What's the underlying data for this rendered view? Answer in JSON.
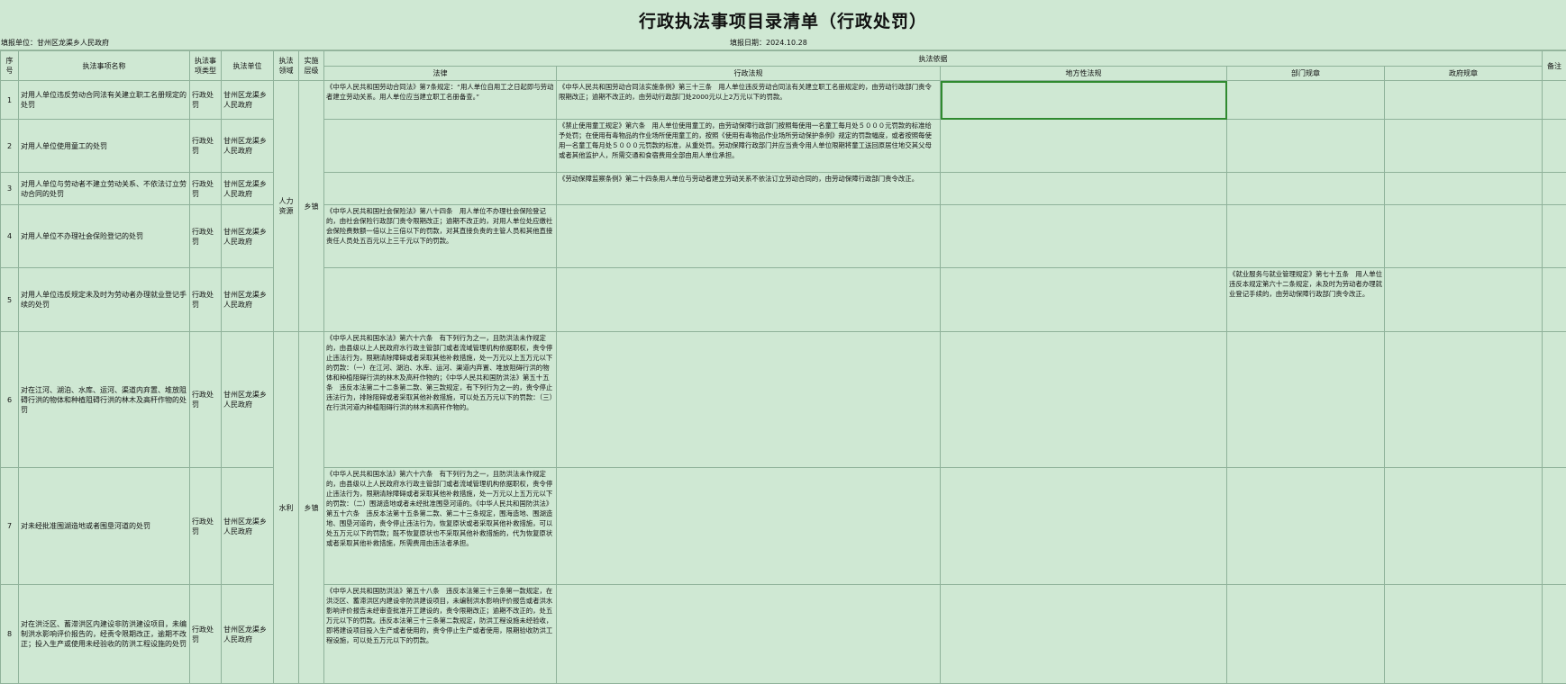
{
  "sheet": {
    "title": "行政执法事项目录清单（行政处罚）",
    "unit_label": "填报单位：甘州区龙渠乡人民政府",
    "date_label": "填报日期：2024.10.28"
  },
  "headers": {
    "seq": "序号",
    "name": "执法事项名称",
    "type": "执法事项类型",
    "dept": "执法单位",
    "field": "执法领域",
    "level": "实施层级",
    "basis": "执法依据",
    "law": "法律",
    "admin_reg": "行政法规",
    "local_reg": "地方性法规",
    "dept_rule": "部门规章",
    "gov_rule": "政府规章",
    "note": "备注"
  },
  "groups": {
    "field_a": "人力资源",
    "level_a": "乡镇",
    "field_b": "水利",
    "level_b": "乡镇"
  },
  "rows": [
    {
      "seq": "1",
      "name": "对用人单位违反劳动合同法有关建立职工名册规定的处罚",
      "type": "行政处罚",
      "dept": "甘州区龙渠乡人民政府",
      "law": "《中华人民共和国劳动合同法》第7条规定：“用人单位自用工之日起即与劳动者建立劳动关系。用人单位应当建立职工名册备查。”",
      "admin_reg": "《中华人民共和国劳动合同法实施条例》第三十三条　用人单位违反劳动合同法有关建立职工名册规定的，由劳动行政部门责令限期改正；逾期不改正的，由劳动行政部门处2000元以上2万元以下的罚款。",
      "local_reg": "",
      "dept_rule": "",
      "gov_rule": "",
      "note": ""
    },
    {
      "seq": "2",
      "name": "对用人单位使用童工的处罚",
      "type": "行政处罚",
      "dept": "甘州区龙渠乡人民政府",
      "law": "",
      "admin_reg": "《禁止使用童工规定》第六条　用人单位使用童工的，由劳动保障行政部门按照每使用一名童工每月处５０００元罚款的标准给予处罚；在使用有毒物品的作业场所使用童工的，按照《使用有毒物品作业场所劳动保护条例》规定的罚款幅度，或者按照每使用一名童工每月处５０００元罚款的标准，从重处罚。劳动保障行政部门并应当责令用人单位限期将童工送回原居住地交其父母或者其他监护人，所需交通和食宿费用全部由用人单位承担。",
      "local_reg": "",
      "dept_rule": "",
      "gov_rule": "",
      "note": ""
    },
    {
      "seq": "3",
      "name": "对用人单位与劳动者不建立劳动关系、不依法订立劳动合同的处罚",
      "type": "行政处罚",
      "dept": "甘州区龙渠乡人民政府",
      "law": "",
      "admin_reg": "《劳动保障监察条例》第二十四条用人单位与劳动者建立劳动关系不依法订立劳动合同的，由劳动保障行政部门责令改正。",
      "local_reg": "",
      "dept_rule": "",
      "gov_rule": "",
      "note": ""
    },
    {
      "seq": "4",
      "name": "对用人单位不办理社会保险登记的处罚",
      "type": "行政处罚",
      "dept": "甘州区龙渠乡人民政府",
      "law": "《中华人民共和国社会保险法》第八十四条　用人单位不办理社会保险登记的，由社会保险行政部门责令限期改正；逾期不改正的，对用人单位处应缴社会保险费数额一倍以上三倍以下的罚款，对其直接负责的主管人员和其他直接责任人员处五百元以上三千元以下的罚款。",
      "admin_reg": "",
      "local_reg": "",
      "dept_rule": "",
      "gov_rule": "",
      "note": ""
    },
    {
      "seq": "5",
      "name": "对用人单位违反规定未及时为劳动者办理就业登记手续的处罚",
      "type": "行政处罚",
      "dept": "甘州区龙渠乡人民政府",
      "law": "",
      "admin_reg": "",
      "local_reg": "",
      "dept_rule": "《就业服务与就业管理规定》第七十五条　用人单位违反本规定第六十二条规定，未及时为劳动者办理就业登记手续的，由劳动保障行政部门责令改正。",
      "gov_rule": "",
      "note": ""
    },
    {
      "seq": "6",
      "name": "对在江河、湖泊、水库、运河、渠道内弃置、堆放阻碍行洪的物体和种植阻碍行洪的林木及高秆作物的处罚",
      "type": "行政处罚",
      "dept": "甘州区龙渠乡人民政府",
      "law": "《中华人民共和国水法》第六十六条　有下列行为之一，且防洪法未作规定的，由县级以上人民政府水行政主管部门或者流域管理机构依据职权，责令停止违法行为，限期清除障碍或者采取其他补救措施，处一万元以上五万元以下的罚款：（一）在江河、湖泊、水库、运河、渠道内弃置、堆放阻碍行洪的物体和种植阻碍行洪的林木及高秆作物的；《中华人民共和国防洪法》第五十五条　违反本法第二十二条第二款、第三款规定，有下列行为之一的，责令停止违法行为，排除阻碍或者采取其他补救措施，可以处五万元以下的罚款：（三）在行洪河道内种植阻碍行洪的林木和高秆作物的。",
      "admin_reg": "",
      "local_reg": "",
      "dept_rule": "",
      "gov_rule": "",
      "note": ""
    },
    {
      "seq": "7",
      "name": "对未经批准围湖造地或者围垦河道的处罚",
      "type": "行政处罚",
      "dept": "甘州区龙渠乡人民政府",
      "law": "《中华人民共和国水法》第六十六条　有下列行为之一，且防洪法未作规定的，由县级以上人民政府水行政主管部门或者流域管理机构依据职权，责令停止违法行为，限期清除障碍或者采取其他补救措施，处一万元以上五万元以下的罚款：（二）围湖造地或者未经批准围垦河道的。《中华人民共和国防洪法》　第五十六条　违反本法第十五条第二款、第二十三条规定，围海造地、围湖造地、围垦河道的，责令停止违法行为，恢复原状或者采取其他补救措施，可以处五万元以下的罚款；既不恢复原状也不采取其他补救措施的，代为恢复原状或者采取其他补救措施，所需费用由违法者承担。",
      "admin_reg": "",
      "local_reg": "",
      "dept_rule": "",
      "gov_rule": "",
      "note": ""
    },
    {
      "seq": "8",
      "name": "对在洪泛区、蓄滞洪区内建设非防洪建设项目，未编制洪水影响评价报告的，经责令限期改正，逾期不改正；投入生产或使用未经验收的防洪工程设施的处罚",
      "type": "行政处罚",
      "dept": "甘州区龙渠乡人民政府",
      "law": "《中华人民共和国防洪法》第五十八条　违反本法第三十三条第一款规定，在洪泛区、蓄滞洪区内建设非防洪建设项目，未编制洪水影响评价报告或者洪水影响评价报告未经审查批准开工建设的，责令限期改正；逾期不改正的，处五万元以下的罚款。违反本法第三十三条第二款规定，防洪工程设施未经验收，即将建设项目投入生产或者使用的，责令停止生产或者使用，限期验收防洪工程设施，可以处五万元以下的罚款。",
      "admin_reg": "",
      "local_reg": "",
      "dept_rule": "",
      "gov_rule": "",
      "note": ""
    }
  ]
}
